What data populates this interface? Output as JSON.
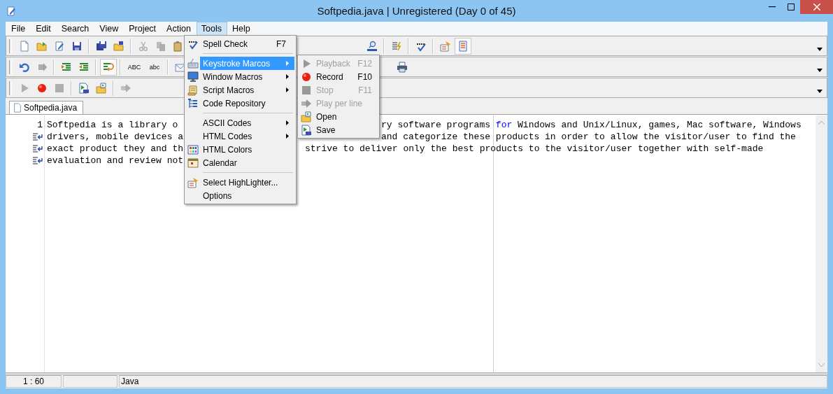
{
  "window": {
    "title": "Softpedia.java | Unregistered (Day 0 of 45)"
  },
  "menu_bar": [
    {
      "label": "File",
      "selected": false
    },
    {
      "label": "Edit",
      "selected": false
    },
    {
      "label": "Search",
      "selected": false
    },
    {
      "label": "View",
      "selected": false
    },
    {
      "label": "Project",
      "selected": false
    },
    {
      "label": "Action",
      "selected": false
    },
    {
      "label": "Tools",
      "selected": true
    },
    {
      "label": "Help",
      "selected": false
    }
  ],
  "toolbars": [
    {
      "left": [
        {
          "kind": "icon",
          "disabled": false
        },
        {
          "kind": "icon",
          "disabled": false
        },
        {
          "kind": "icon",
          "disabled": false
        },
        {
          "kind": "icon",
          "disabled": false
        },
        {
          "kind": "separator"
        },
        {
          "kind": "icon",
          "disabled": false
        },
        {
          "kind": "icon",
          "disabled": false
        },
        {
          "kind": "separator"
        },
        {
          "kind": "icon",
          "disabled": true
        },
        {
          "kind": "icon",
          "disabled": true
        },
        {
          "kind": "icon"
        }
      ],
      "right": [
        {
          "kind": "icon",
          "disabled": false
        },
        {
          "kind": "separator"
        },
        {
          "kind": "icon",
          "disabled": false
        },
        {
          "kind": "separator"
        },
        {
          "kind": "icon",
          "disabled": false
        },
        {
          "kind": "separator"
        },
        {
          "kind": "icon",
          "disabled": false
        },
        {
          "kind": "icon",
          "disabled": false,
          "pressed": true
        }
      ]
    },
    {
      "left": [
        {
          "kind": "icon",
          "disabled": false
        },
        {
          "kind": "icon",
          "disabled": true
        },
        {
          "kind": "separator"
        },
        {
          "kind": "icon",
          "disabled": false
        },
        {
          "kind": "icon",
          "disabled": false
        },
        {
          "kind": "separator"
        },
        {
          "kind": "icon",
          "disabled": false,
          "pressed": true
        },
        {
          "kind": "separator"
        },
        {
          "kind": "text",
          "label": "ABC"
        },
        {
          "kind": "text",
          "label": "abc"
        },
        {
          "kind": "separator"
        },
        {
          "kind": "icon"
        }
      ],
      "right": [
        {
          "kind": "icon",
          "disabled": false
        }
      ]
    },
    {
      "left": [
        {
          "kind": "icon",
          "disabled": true
        },
        {
          "kind": "icon",
          "disabled": false
        },
        {
          "kind": "icon",
          "disabled": true
        },
        {
          "kind": "separator"
        },
        {
          "kind": "icon",
          "disabled": false
        },
        {
          "kind": "icon",
          "disabled": false
        },
        {
          "kind": "separator"
        },
        {
          "kind": "icon",
          "disabled": true
        }
      ]
    }
  ],
  "tabs": [
    {
      "label": "Softpedia.java",
      "selected": true
    }
  ],
  "editor": {
    "lines": [
      {
        "gutter": "1",
        "kind": "numbered",
        "left": "Softpedia is a library o",
        "right": [
          {
            "text": "ry software programs ",
            "keyword": false
          },
          {
            "text": "for",
            "keyword": true
          },
          {
            "text": " Windows and Unix/Linux, games, Mac software, Windows",
            "keyword": false
          }
        ]
      },
      {
        "kind": "wrapped",
        "left": "drivers, mobile devices a",
        "right": [
          {
            "text": "and categorize these products in order to allow the visitor/user to find the",
            "keyword": false
          }
        ]
      },
      {
        "kind": "wrapped",
        "left": "exact product they and th",
        "right": [
          {
            "text": "strive to deliver only the best products to the visitor/user together with self-made",
            "keyword": false
          }
        ]
      },
      {
        "kind": "wrapped",
        "left": "evaluation and review not"
      }
    ]
  },
  "tools_menu": [
    {
      "kind": "item",
      "label": "Spell Check",
      "shortcut": "F7",
      "submenu": false,
      "selected": false
    },
    {
      "kind": "separator"
    },
    {
      "kind": "item",
      "label": "Keystroke Marcos",
      "submenu": true,
      "selected": true
    },
    {
      "kind": "item",
      "label": "Window Macros",
      "submenu": true,
      "selected": false
    },
    {
      "kind": "item",
      "label": "Script Macros",
      "submenu": true,
      "selected": false
    },
    {
      "kind": "item",
      "label": "Code Repository",
      "submenu": false,
      "selected": false
    },
    {
      "kind": "separator"
    },
    {
      "kind": "item",
      "label": "ASCII Codes",
      "submenu": true,
      "selected": false
    },
    {
      "kind": "item",
      "label": "HTML Codes",
      "submenu": true,
      "selected": false
    },
    {
      "kind": "item",
      "label": "HTML Colors",
      "submenu": false,
      "selected": false
    },
    {
      "kind": "item",
      "label": "Calendar",
      "submenu": false,
      "selected": false
    },
    {
      "kind": "separator"
    },
    {
      "kind": "item",
      "label": "Select HighLighter...",
      "submenu": false,
      "selected": false
    },
    {
      "kind": "item",
      "label": "Options",
      "submenu": false,
      "selected": false
    }
  ],
  "keystroke_submenu": [
    {
      "label": "Playback",
      "shortcut": "F12",
      "disabled": true
    },
    {
      "label": "Record",
      "shortcut": "F10",
      "disabled": false
    },
    {
      "label": "Stop",
      "shortcut": "F11",
      "disabled": true
    },
    {
      "label": "Play per line",
      "disabled": true
    },
    {
      "label": "Open",
      "disabled": false
    },
    {
      "label": "Save",
      "disabled": false
    }
  ],
  "status_bar": {
    "position": "1 : 60",
    "language": "Java"
  }
}
